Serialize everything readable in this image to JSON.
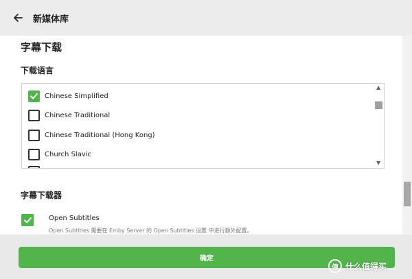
{
  "header": {
    "title": "新媒体库",
    "back_icon": "arrow-left-icon"
  },
  "section": {
    "title": "字幕下载",
    "languages_label": "下载语言",
    "languages": [
      {
        "label": "Chinese Simplified",
        "checked": true
      },
      {
        "label": "Chinese Traditional",
        "checked": false
      },
      {
        "label": "Chinese Traditional (Hong Kong)",
        "checked": false
      },
      {
        "label": "Church Slavic",
        "checked": false
      }
    ],
    "downloaders_label": "字幕下载器",
    "downloader": {
      "name": "Open Subtitles",
      "checked": true,
      "description": "Open Subtitles 需要在 Emby Server 的 Open Subtitles 设置 中进行额外配置。"
    }
  },
  "footer": {
    "confirm_label": "确定"
  },
  "watermark": {
    "logo_char": "值",
    "text": "什么值得买"
  },
  "colors": {
    "accent": "#52b54b",
    "header_bg": "#ececec",
    "footer_bg": "#e9e9e9"
  }
}
